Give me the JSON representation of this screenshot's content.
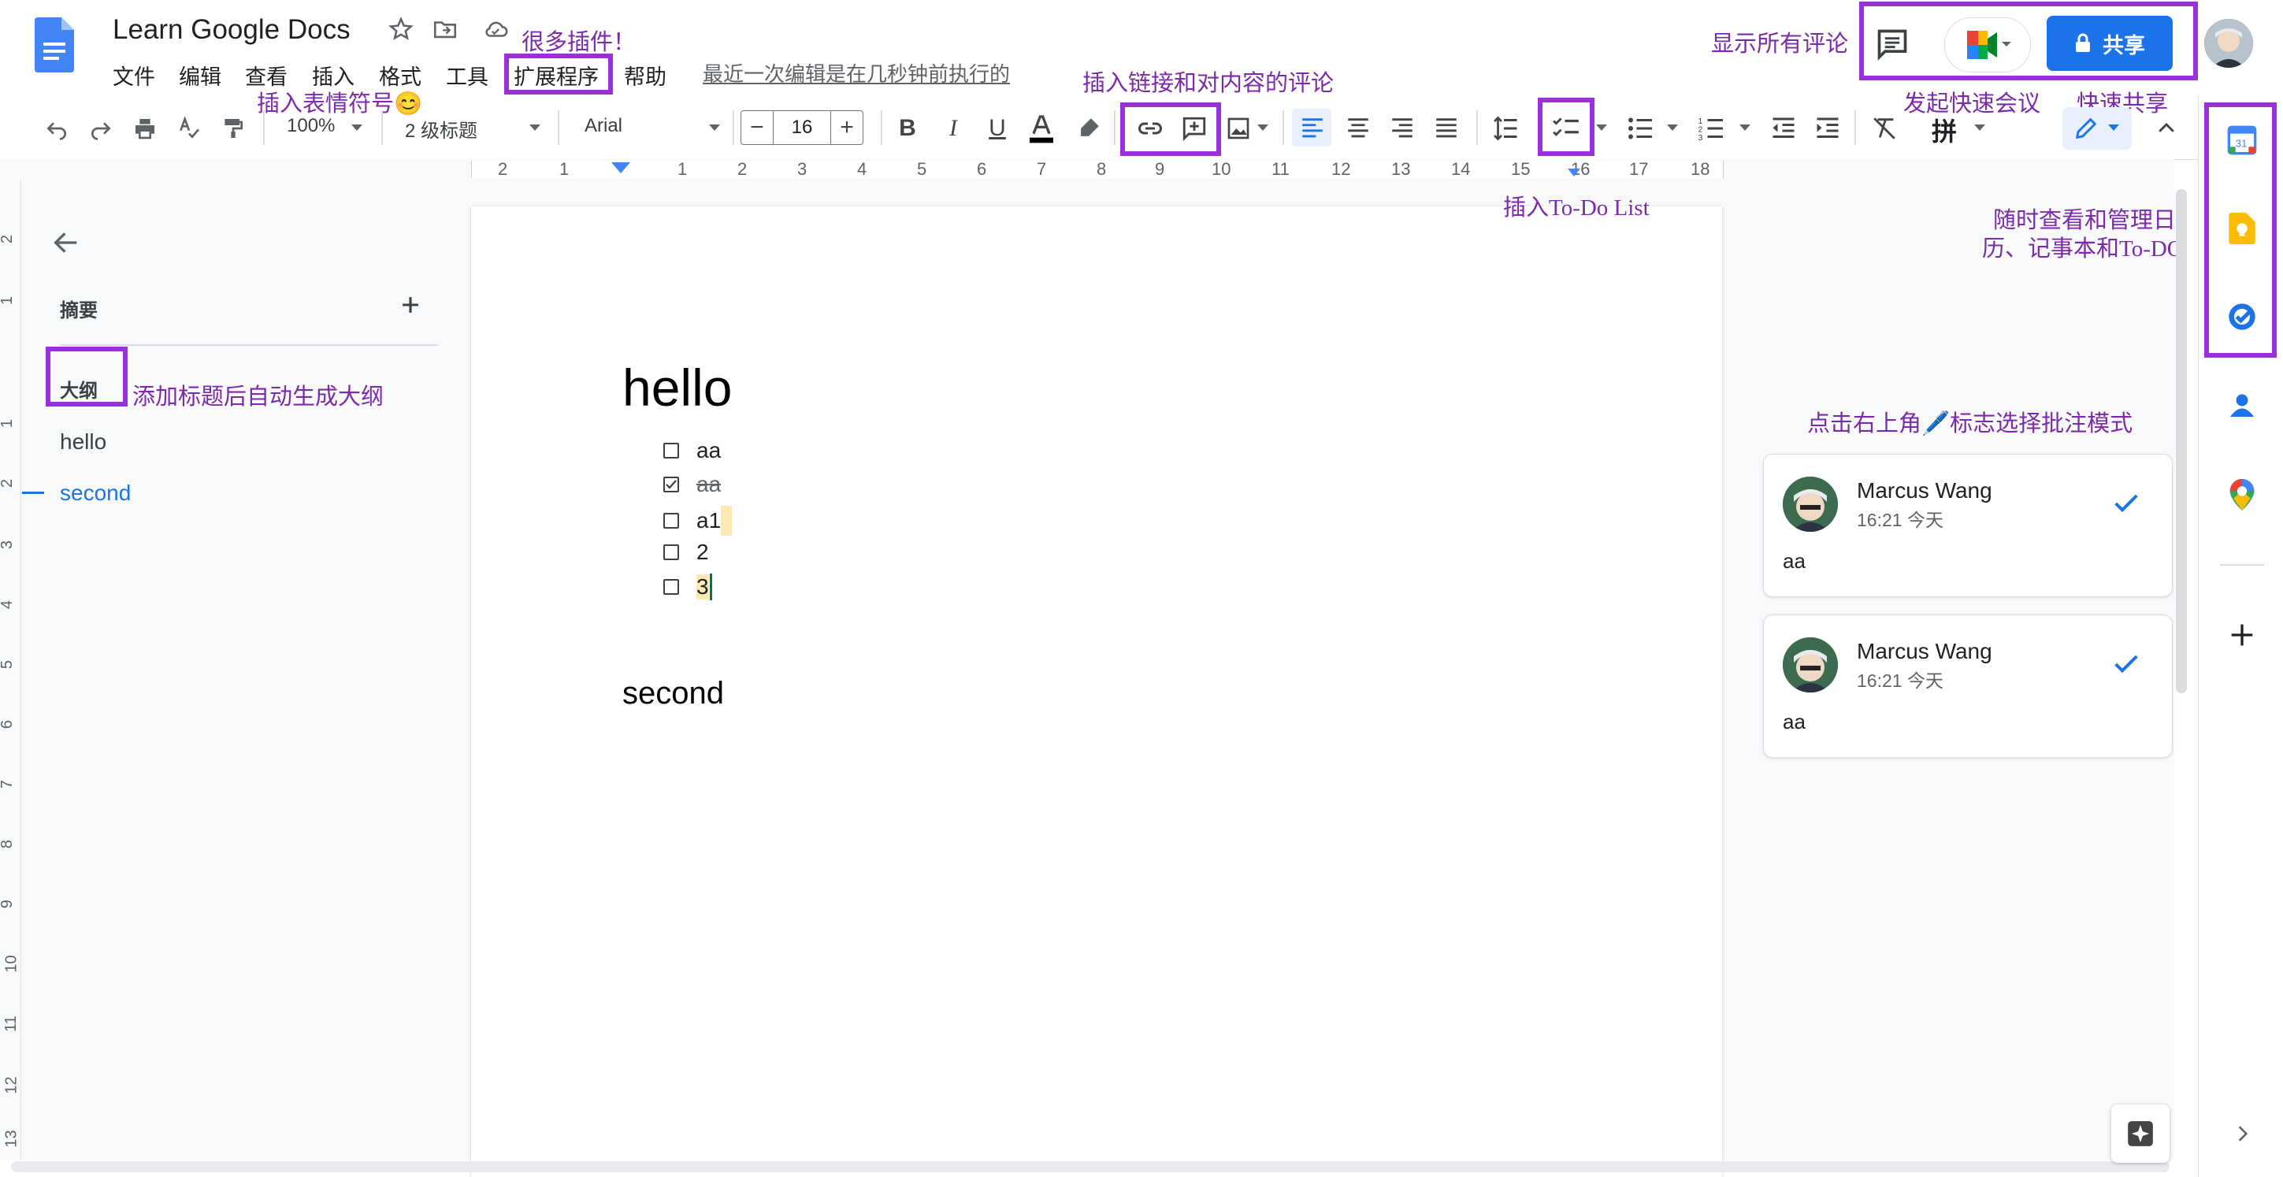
{
  "doc": {
    "title": "Learn Google Docs",
    "last_edit": "最近一次编辑是在几秒钟前执行的"
  },
  "menu": [
    "文件",
    "编辑",
    "查看",
    "插入",
    "格式",
    "工具",
    "扩展程序",
    "帮助"
  ],
  "header": {
    "share_label": "共享"
  },
  "toolbar": {
    "zoom": "100%",
    "style": "2 级标题",
    "font": "Arial",
    "font_size": "16",
    "ime": "拼"
  },
  "ruler": [
    "2",
    "1",
    "1",
    "2",
    "3",
    "4",
    "5",
    "6",
    "7",
    "8",
    "9",
    "10",
    "11",
    "12",
    "13",
    "14",
    "15",
    "16",
    "17",
    "18"
  ],
  "vruler": [
    "2",
    "1",
    "1",
    "2",
    "3",
    "4",
    "5",
    "6",
    "7",
    "8",
    "9",
    "10",
    "11",
    "12",
    "13"
  ],
  "outline": {
    "summary_label": "摘要",
    "outline_label": "大纲",
    "items": [
      "hello",
      "second"
    ]
  },
  "document": {
    "heading1": "hello",
    "todos": [
      {
        "text": "aa",
        "checked": false
      },
      {
        "text": "aa",
        "checked": true
      },
      {
        "text": "a1",
        "checked": false
      },
      {
        "text": "2",
        "checked": false
      },
      {
        "text": "3",
        "checked": false
      }
    ],
    "heading2": "second"
  },
  "comments": [
    {
      "author": "Marcus Wang",
      "time": "16:21 今天",
      "body": "aa"
    },
    {
      "author": "Marcus Wang",
      "time": "16:21 今天",
      "body": "aa"
    }
  ],
  "annotations": {
    "plugins": "很多插件！",
    "emoji": "插入表情符号😊",
    "link_comment": "插入链接和对内容的评论",
    "todo_list": "插入To-Do List",
    "show_comments": "显示所有评论",
    "quick_meeting": "发起快速会议",
    "quick_share": "快速共享",
    "side_tools_1": "随时查看和管理日",
    "side_tools_2": "历、记事本和To-DO",
    "outline_auto": "添加标题后自动生成大纲",
    "suggest_mode": "点击右上角🖊️标志选择批注模式"
  },
  "colors": {
    "accent": "#1a73e8",
    "annotation": "#9b30d9",
    "highlight": "#fce8b2"
  }
}
